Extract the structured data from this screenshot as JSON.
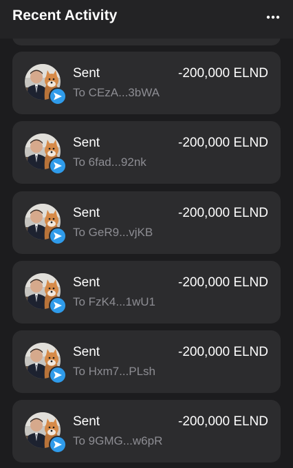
{
  "header": {
    "title": "Recent Activity",
    "more_icon": "ellipsis-horizontal-icon"
  },
  "colors": {
    "background": "#1c1c1e",
    "card": "#2c2c2e",
    "badge": "#2f9bea",
    "secondary_text": "#8d8d93"
  },
  "activities": [
    {
      "type": "Sent",
      "recipient": "To CEzA...3bWA",
      "amount": "-200,000 ELND",
      "icon": "send-arrow-icon"
    },
    {
      "type": "Sent",
      "recipient": "To 6fad...92nk",
      "amount": "-200,000 ELND",
      "icon": "send-arrow-icon"
    },
    {
      "type": "Sent",
      "recipient": "To GeR9...vjKB",
      "amount": "-200,000 ELND",
      "icon": "send-arrow-icon"
    },
    {
      "type": "Sent",
      "recipient": "To FzK4...1wU1",
      "amount": "-200,000 ELND",
      "icon": "send-arrow-icon"
    },
    {
      "type": "Sent",
      "recipient": "To Hxm7...PLsh",
      "amount": "-200,000 ELND",
      "icon": "send-arrow-icon"
    },
    {
      "type": "Sent",
      "recipient": "To 9GMG...w6pR",
      "amount": "-200,000 ELND",
      "icon": "send-arrow-icon"
    }
  ]
}
